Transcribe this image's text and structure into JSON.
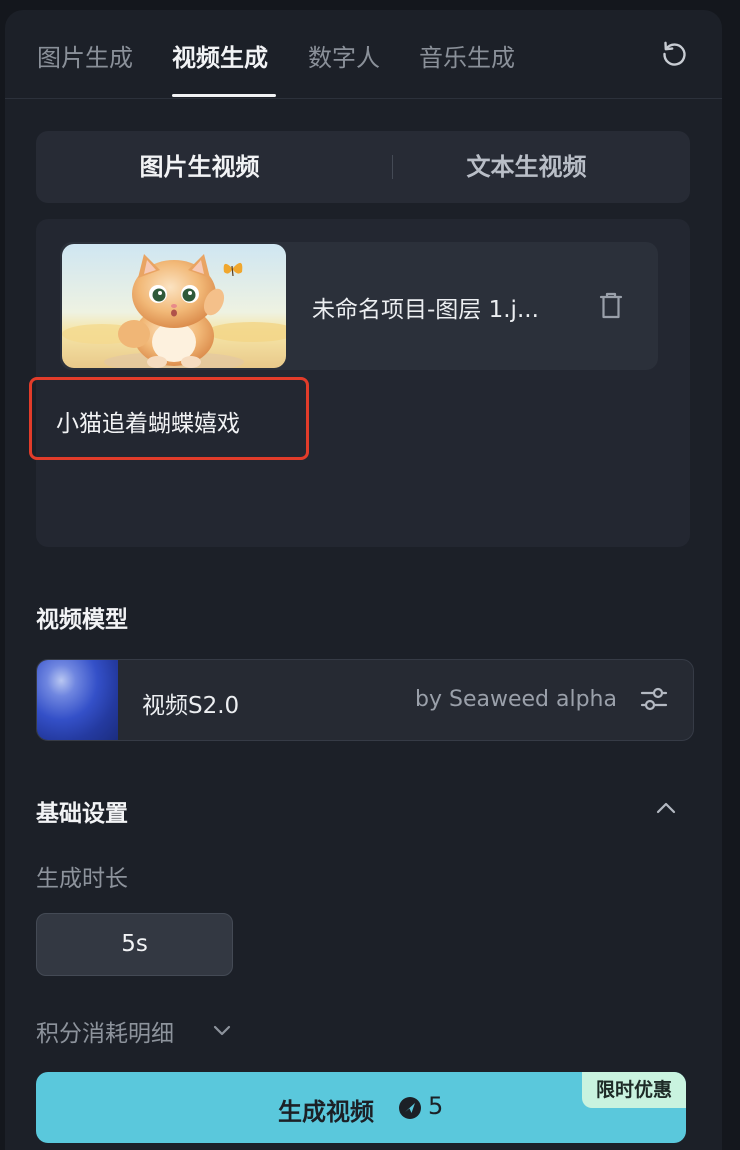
{
  "tabs": [
    {
      "label": "图片生成"
    },
    {
      "label": "视频生成",
      "active": true
    },
    {
      "label": "数字人"
    },
    {
      "label": "音乐生成"
    }
  ],
  "segment": {
    "left": "图片生视频",
    "right": "文本生视频",
    "selected": "图片生视频"
  },
  "upload": {
    "file_name": "未命名项目-图层 1.j...",
    "prompt": "小猫追着蝴蝶嬉戏"
  },
  "model": {
    "section_title": "视频模型",
    "name": "视频S2.0",
    "by": "by Seaweed alpha"
  },
  "basic": {
    "section_title": "基础设置",
    "duration_label": "生成时长",
    "duration_value": "5s",
    "detail_label": "积分消耗明细"
  },
  "generate": {
    "label": "生成视频",
    "cost": "5",
    "badge": "限时优惠"
  },
  "colors": {
    "accent": "#5ac8dc",
    "highlight_border": "#e23c2a",
    "badge_bg": "#c9f3df",
    "panel_bg": "#1c2028"
  },
  "icons": [
    "refresh-icon",
    "trash-icon",
    "sliders-icon",
    "chevron-up-icon",
    "chevron-down-icon",
    "coin-icon"
  ]
}
